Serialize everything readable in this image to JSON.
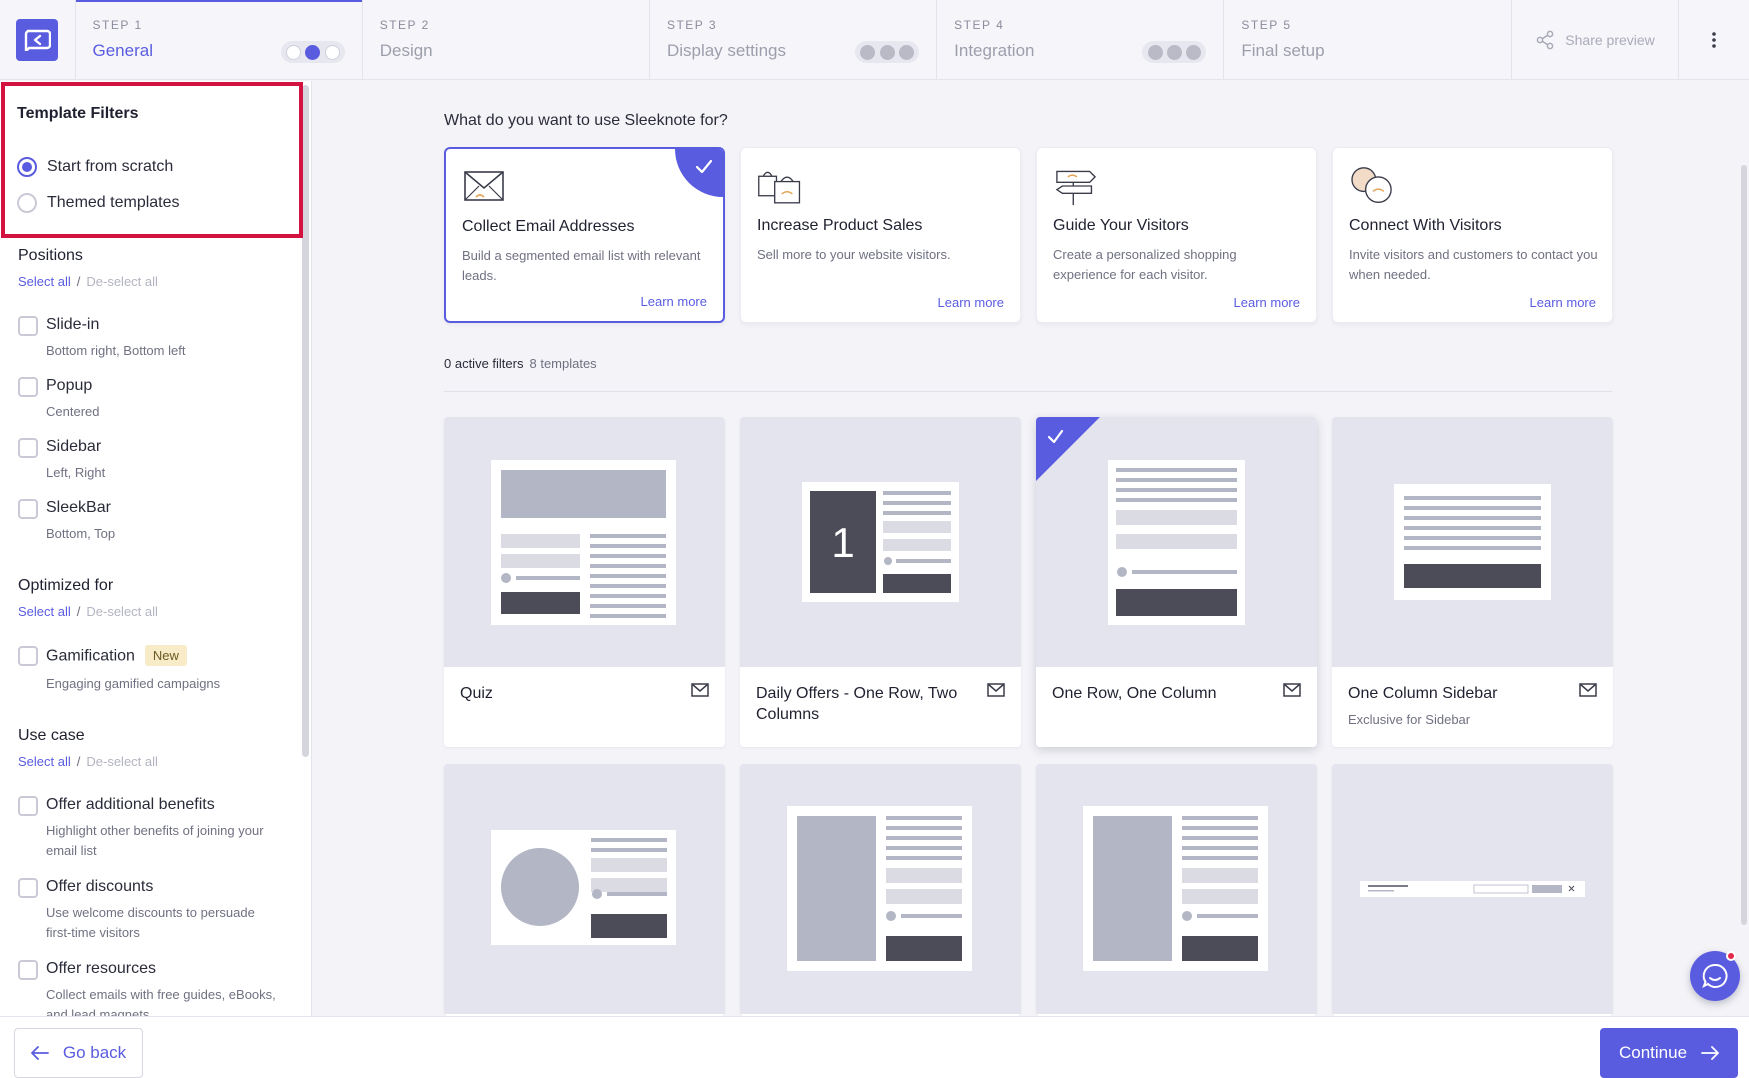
{
  "steps": [
    {
      "num": "STEP 1",
      "title": "General"
    },
    {
      "num": "STEP 2",
      "title": "Design"
    },
    {
      "num": "STEP 3",
      "title": "Display settings"
    },
    {
      "num": "STEP 4",
      "title": "Integration"
    },
    {
      "num": "STEP 5",
      "title": "Final setup"
    }
  ],
  "share_label": "Share preview",
  "filters": {
    "title": "Template Filters",
    "scratch": "Start from scratch",
    "themed": "Themed templates"
  },
  "select_all": "Select all",
  "deselect_all": "De-select all",
  "sep": "/",
  "positions": {
    "title": "Positions",
    "items": [
      {
        "label": "Slide-in",
        "sub": "Bottom right, Bottom left"
      },
      {
        "label": "Popup",
        "sub": "Centered"
      },
      {
        "label": "Sidebar",
        "sub": "Left, Right"
      },
      {
        "label": "SleekBar",
        "sub": "Bottom, Top"
      }
    ]
  },
  "optimized": {
    "title": "Optimized for",
    "items": [
      {
        "label": "Gamification",
        "badge": "New",
        "sub": "Engaging gamified campaigns"
      }
    ]
  },
  "usecase_filter": {
    "title": "Use case",
    "items": [
      {
        "label": "Offer additional benefits",
        "sub": "Highlight other benefits of joining your email list"
      },
      {
        "label": "Offer discounts",
        "sub": "Use welcome discounts to persuade first-time visitors"
      },
      {
        "label": "Offer resources",
        "sub": "Collect emails with free guides, eBooks, and lead magnets"
      }
    ]
  },
  "main": {
    "question": "What do you want to use Sleeknote for?",
    "usecases": [
      {
        "title": "Collect Email Addresses",
        "desc": "Build a segmented email list with relevant leads.",
        "learn": "Learn more"
      },
      {
        "title": "Increase Product Sales",
        "desc": "Sell more to your website visitors.",
        "learn": "Learn more"
      },
      {
        "title": "Guide Your Visitors",
        "desc": "Create a personalized shopping experience for each visitor.",
        "learn": "Learn more"
      },
      {
        "title": "Connect With Visitors",
        "desc": "Invite visitors and customers to contact you when needed.",
        "learn": "Learn more"
      }
    ],
    "active_filters": "0 active filters",
    "template_count": "8 templates",
    "templates": [
      {
        "name": "Quiz",
        "sub": ""
      },
      {
        "name": "Daily Offers - One Row, Two Columns",
        "sub": ""
      },
      {
        "name": "One Row, One Column",
        "sub": ""
      },
      {
        "name": "One Column Sidebar",
        "sub": "Exclusive for Sidebar"
      }
    ]
  },
  "bottom": {
    "back": "Go back",
    "continue": "Continue"
  },
  "colors": {
    "accent": "#5a5ce0",
    "highlight": "#d3123f"
  }
}
